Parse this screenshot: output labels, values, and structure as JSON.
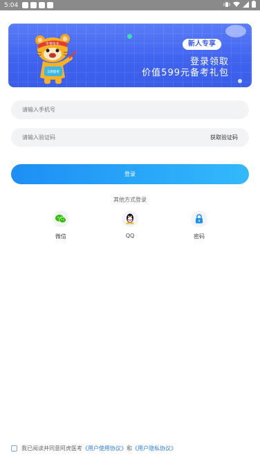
{
  "status_bar": {
    "time": "5:04"
  },
  "banner": {
    "tag": "新人专享",
    "line1": "登录领取",
    "line2": "价值599元备考礼包",
    "mascot_headband": "牛学牛牛",
    "mascot_shirt": "马原医考"
  },
  "form": {
    "phone_placeholder": "请输入手机号",
    "code_placeholder": "请输入验证码",
    "get_code_label": "获取验证码",
    "login_label": "登录"
  },
  "other_login": {
    "title": "其他方式登录",
    "options": [
      {
        "label": "微信",
        "icon": "wechat-icon"
      },
      {
        "label": "QQ",
        "icon": "qq-icon"
      },
      {
        "label": "密码",
        "icon": "lock-icon"
      }
    ]
  },
  "agreement": {
    "prefix": "我已阅读并同意阿虎医考",
    "user_agreement": "《用户使用协议》",
    "and": "和",
    "privacy_policy": "《用户隐私协议》"
  },
  "colors": {
    "primary_blue": "#1d8ff5",
    "banner_blue": "#3e62ef",
    "link_blue": "#2f7de1",
    "wechat_green": "#2dc100"
  }
}
